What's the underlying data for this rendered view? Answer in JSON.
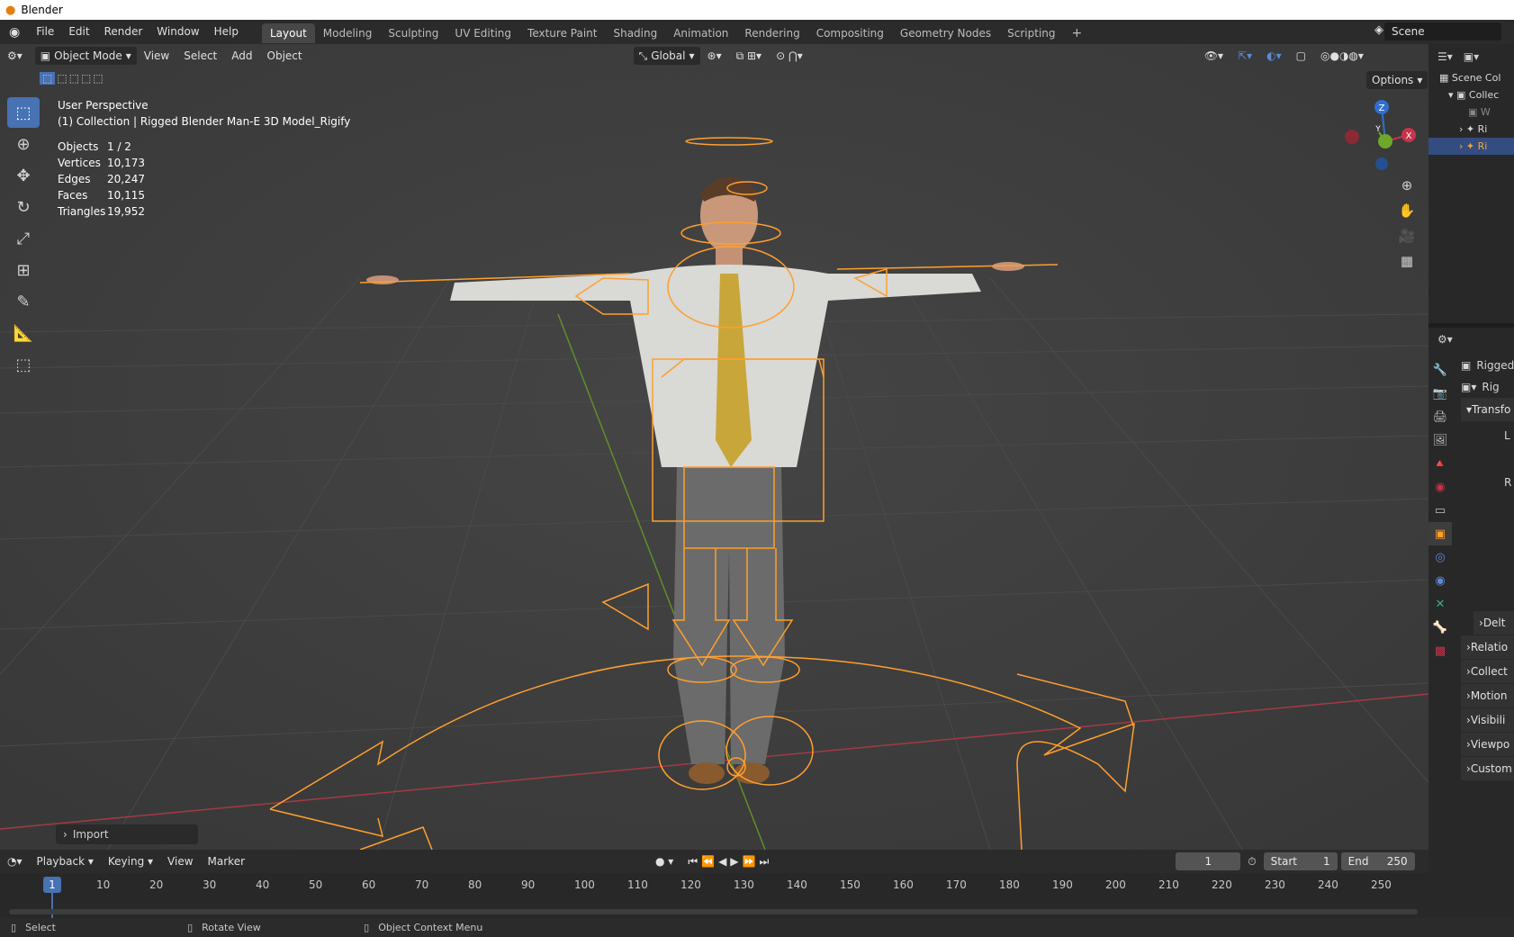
{
  "window": {
    "title": "Blender"
  },
  "menu": [
    "File",
    "Edit",
    "Render",
    "Window",
    "Help"
  ],
  "workspaces": [
    "Layout",
    "Modeling",
    "Sculpting",
    "UV Editing",
    "Texture Paint",
    "Shading",
    "Animation",
    "Rendering",
    "Compositing",
    "Geometry Nodes",
    "Scripting"
  ],
  "active_workspace": "Layout",
  "scene": {
    "label": "Scene"
  },
  "viewport_header": {
    "mode": "Object Mode",
    "menus": [
      "View",
      "Select",
      "Add",
      "Object"
    ],
    "orientation": "Global",
    "options": "Options"
  },
  "viewport_info": {
    "view": "User Perspective",
    "collection": "(1) Collection | Rigged Blender Man-E 3D Model_Rigify",
    "stats": [
      {
        "label": "Objects",
        "value": "1 / 2"
      },
      {
        "label": "Vertices",
        "value": "10,173"
      },
      {
        "label": "Edges",
        "value": "20,247"
      },
      {
        "label": "Faces",
        "value": "10,115"
      },
      {
        "label": "Triangles",
        "value": "19,952"
      }
    ]
  },
  "gizmo_axes": {
    "z": "Z",
    "y": "Y",
    "x": "X"
  },
  "import_panel": {
    "label": "Import"
  },
  "timeline": {
    "menus": [
      "Playback",
      "Keying",
      "View",
      "Marker"
    ],
    "current_frame": "1",
    "start_label": "Start",
    "start": "1",
    "end_label": "End",
    "end": "250",
    "ticks": [
      "1",
      "10",
      "20",
      "30",
      "40",
      "50",
      "60",
      "70",
      "80",
      "90",
      "100",
      "110",
      "120",
      "130",
      "140",
      "150",
      "160",
      "170",
      "180",
      "190",
      "200",
      "210",
      "220",
      "230",
      "240",
      "250"
    ]
  },
  "outliner": {
    "items": [
      "Scene Col",
      "Collec",
      "W",
      "Ri",
      "Ri"
    ]
  },
  "properties": {
    "object_name": "Rigged",
    "data_name": "Rig",
    "panels": [
      "Transfo",
      "Delt",
      "Relatio",
      "Collect",
      "Motion",
      "Visibili",
      "Viewpo",
      "Custom"
    ],
    "location_label": "L",
    "rotation_label": "R"
  },
  "statusbar": {
    "items": [
      "Select",
      "Rotate View",
      "Object Context Menu"
    ]
  },
  "colors": {
    "accent": "#4772b3",
    "selection": "#ff9f2e",
    "x_axis": "#c7334b",
    "y_axis": "#6ea82a",
    "z_axis": "#2f6fd0"
  }
}
